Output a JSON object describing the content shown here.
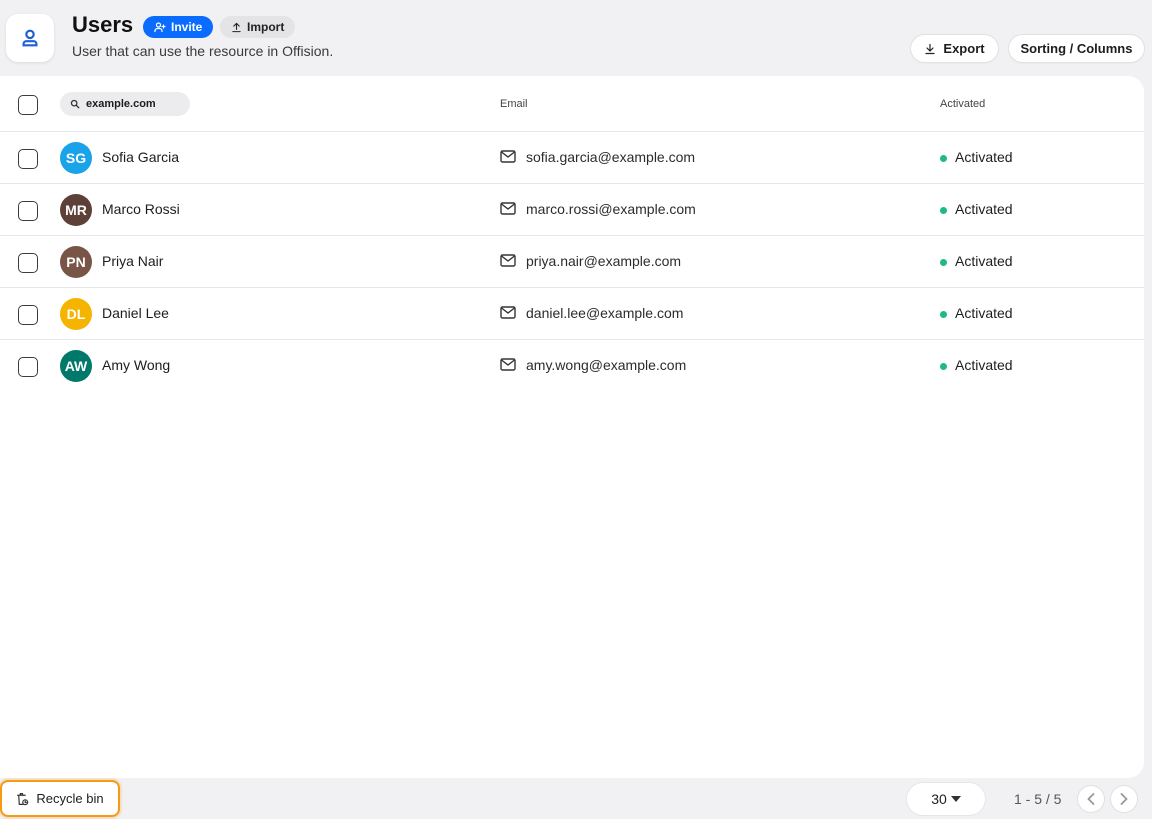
{
  "header": {
    "title": "Users",
    "subtitle": "User that can use the resource in Offision.",
    "invite_label": "Invite",
    "import_label": "Import",
    "export_label": "Export",
    "sorting_label": "Sorting / Columns",
    "app_icon": "user-icon"
  },
  "table": {
    "search_value": "example.com",
    "email_header": "Email",
    "activated_header": "Activated",
    "rows": [
      {
        "initials": "SG",
        "name": "Sofia Garcia",
        "email": "sofia.garcia@example.com",
        "status": "Activated",
        "avatar_color": "#1aa3e8"
      },
      {
        "initials": "MR",
        "name": "Marco Rossi",
        "email": "marco.rossi@example.com",
        "status": "Activated",
        "avatar_color": "#5d4037"
      },
      {
        "initials": "PN",
        "name": "Priya Nair",
        "email": "priya.nair@example.com",
        "status": "Activated",
        "avatar_color": "#795548"
      },
      {
        "initials": "DL",
        "name": "Daniel Lee",
        "email": "daniel.lee@example.com",
        "status": "Activated",
        "avatar_color": "#f4b400"
      },
      {
        "initials": "AW",
        "name": "Amy Wong",
        "email": "amy.wong@example.com",
        "status": "Activated",
        "avatar_color": "#00796b"
      }
    ]
  },
  "footer": {
    "recycle_label": "Recycle bin",
    "per_page": "30",
    "range": "1 - 5 / 5"
  },
  "colors": {
    "accent": "#0a6cff",
    "status_active": "#1fba7d",
    "highlight": "#f59a12"
  }
}
